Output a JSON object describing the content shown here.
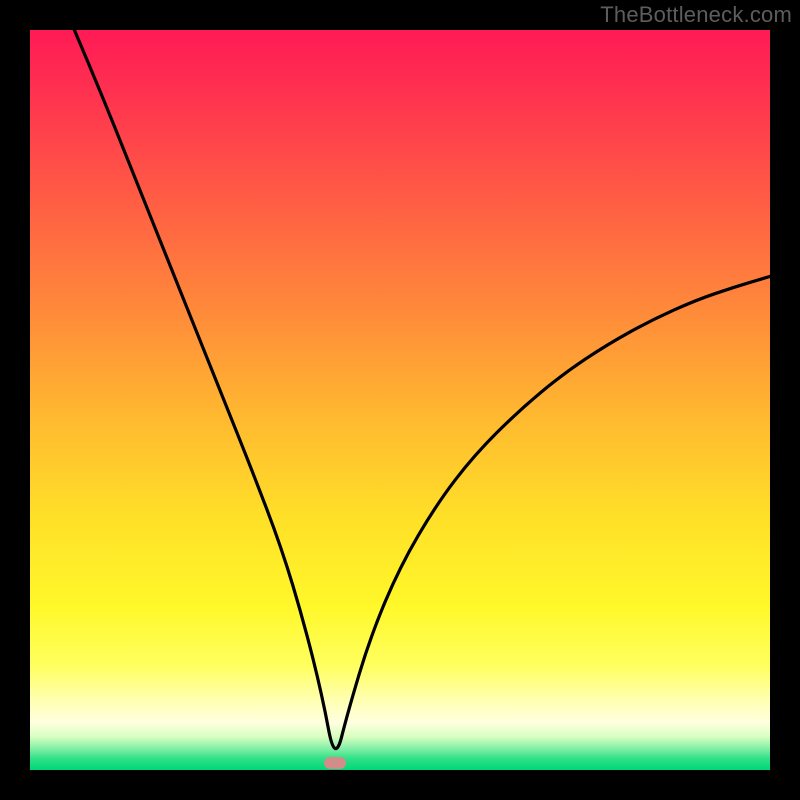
{
  "watermark": "TheBottleneck.com",
  "marker": {
    "x_pct": 41.2,
    "y_from_bottom_pct": 0.9,
    "color": "#d28c8a"
  },
  "chart_data": {
    "type": "line",
    "title": "",
    "xlabel": "",
    "ylabel": "",
    "xlim": [
      0,
      100
    ],
    "ylim": [
      0,
      100
    ],
    "grid": false,
    "legend": false,
    "annotations": [
      {
        "text": "TheBottleneck.com",
        "position": "top-right"
      }
    ],
    "series": [
      {
        "name": "bottleneck-curve",
        "description": "V-shaped curve with minimum at ~41% x. Left branch starts at top-left (x≈6, y=100) descending steeply; right branch rises with decreasing slope to upper-right (x=100, y≈67). y-values are % of plot height from bottom.",
        "x": [
          6.0,
          10,
          14,
          18,
          22,
          26,
          30,
          34,
          37,
          39.5,
          41.2,
          43,
          46,
          50,
          55,
          60,
          66,
          72,
          78,
          84,
          90,
          95,
          100
        ],
        "y": [
          100,
          90.5,
          80.5,
          70.5,
          60.5,
          50.5,
          40.5,
          30,
          20,
          10,
          0.9,
          8,
          18,
          27.5,
          36,
          42.5,
          48.5,
          53.5,
          57.5,
          60.8,
          63.5,
          65.2,
          66.7
        ]
      }
    ],
    "marker_point": {
      "x": 41.2,
      "y": 0.9
    },
    "background_gradient_stops": [
      {
        "pct": 0,
        "color": "#ff1a55"
      },
      {
        "pct": 8,
        "color": "#ff3050"
      },
      {
        "pct": 22,
        "color": "#ff5a45"
      },
      {
        "pct": 38,
        "color": "#ff8a3a"
      },
      {
        "pct": 52,
        "color": "#ffb830"
      },
      {
        "pct": 66,
        "color": "#ffe028"
      },
      {
        "pct": 78,
        "color": "#fff82a"
      },
      {
        "pct": 86,
        "color": "#ffff60"
      },
      {
        "pct": 90,
        "color": "#ffffa8"
      },
      {
        "pct": 93.5,
        "color": "#ffffe0"
      },
      {
        "pct": 95.5,
        "color": "#d8ffc0"
      },
      {
        "pct": 97,
        "color": "#88f0a8"
      },
      {
        "pct": 98.5,
        "color": "#2ee087"
      },
      {
        "pct": 100,
        "color": "#00d878"
      }
    ]
  }
}
